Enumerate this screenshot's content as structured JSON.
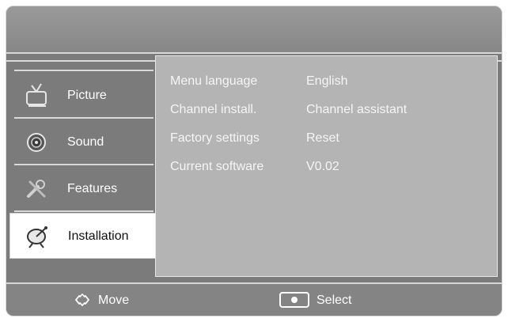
{
  "sidebar": {
    "items": [
      {
        "label": "Picture",
        "icon": "tv-icon"
      },
      {
        "label": "Sound",
        "icon": "speaker-icon"
      },
      {
        "label": "Features",
        "icon": "tools-icon"
      },
      {
        "label": "Installation",
        "icon": "satellite-dish-icon",
        "active": true
      }
    ]
  },
  "installation": {
    "rows": [
      {
        "name": "Menu language",
        "value": "English"
      },
      {
        "name": "Channel install.",
        "value": "Channel assistant"
      },
      {
        "name": "Factory settings",
        "value": "Reset"
      },
      {
        "name": "Current software",
        "value": "V0.02"
      }
    ]
  },
  "footer": {
    "move_label": "Move",
    "select_label": "Select"
  },
  "colors": {
    "panel": "#7b7b7b",
    "content": "#b4b4b4",
    "active": "#ffffff"
  }
}
